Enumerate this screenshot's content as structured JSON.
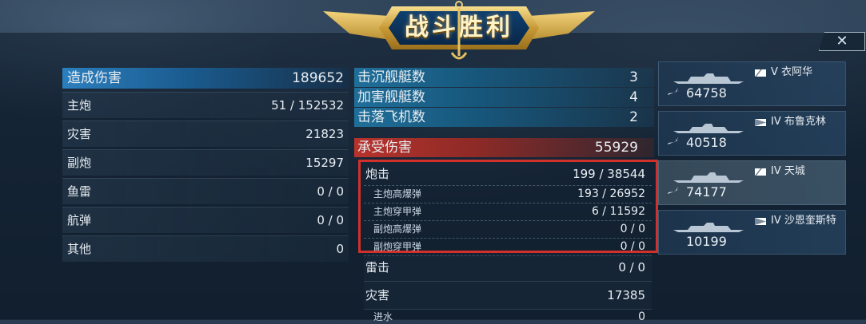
{
  "title": "战斗胜利",
  "close_icon_text": "✕",
  "left_panel": {
    "header": {
      "label": "造成伤害",
      "value": "189652"
    },
    "rows": [
      {
        "label": "主炮",
        "value": "51 / 152532"
      },
      {
        "label": "灾害",
        "value": "21823"
      },
      {
        "label": "副炮",
        "value": "15297"
      },
      {
        "label": "鱼雷",
        "value": "0 / 0"
      },
      {
        "label": "航弹",
        "value": "0 / 0"
      },
      {
        "label": "其他",
        "value": "0"
      }
    ]
  },
  "stats": [
    {
      "label": "击沉舰艇数",
      "value": "3"
    },
    {
      "label": "加害舰艇数",
      "value": "4"
    },
    {
      "label": "击落飞机数",
      "value": "2"
    }
  ],
  "damage_taken": {
    "label": "承受伤害",
    "value": "55929"
  },
  "gunfire": {
    "label": "炮击",
    "value": "199 / 38544",
    "items": [
      {
        "label": "主炮高爆弹",
        "value": "193 / 26952"
      },
      {
        "label": "主炮穿甲弹",
        "value": "6 / 11592"
      },
      {
        "label": "副炮高爆弹",
        "value": "0 / 0"
      },
      {
        "label": "副炮穿甲弹",
        "value": "0 / 0"
      }
    ]
  },
  "lower_rows": [
    {
      "label": "雷击",
      "value": "0 / 0"
    },
    {
      "label": "灾害",
      "value": "17385"
    }
  ],
  "flooding": {
    "label": "进水",
    "value": "0"
  },
  "ships": [
    {
      "tier": "V",
      "name": "衣阿华",
      "damage": "64758"
    },
    {
      "tier": "IV",
      "name": "布鲁克林",
      "damage": "40518"
    },
    {
      "tier": "IV",
      "name": "天城",
      "damage": "74177"
    },
    {
      "tier": "IV",
      "name": "沙恩奎斯特",
      "damage": "10199"
    }
  ],
  "colors": {
    "accent_blue": "#2b7fbe",
    "accent_red": "#b7332c",
    "highlight_border": "#d2302b",
    "gold": "#c89a36"
  },
  "icons": [
    "anchor-icon",
    "wing-icon",
    "close-icon",
    "ship-silhouette-icon",
    "flag-icon",
    "plane-icon"
  ]
}
